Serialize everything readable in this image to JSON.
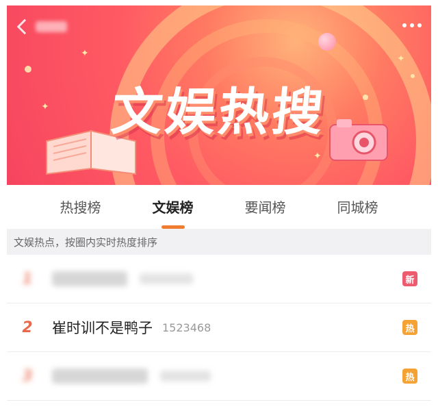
{
  "header": {
    "back_label": "返回",
    "banner_title": "文娱热搜"
  },
  "tabs": [
    {
      "label": "热搜榜",
      "active": false
    },
    {
      "label": "文娱榜",
      "active": true
    },
    {
      "label": "要闻榜",
      "active": false
    },
    {
      "label": "同城榜",
      "active": false
    }
  ],
  "subheader": "文娱热点，按圈内实时热度排序",
  "list": {
    "items": [
      {
        "rank": "1",
        "title": "",
        "count": "",
        "badge": "新",
        "badge_color": "#ee5b6f",
        "blurred": true
      },
      {
        "rank": "2",
        "title": "崔时训不是鸭子",
        "count": "1523468",
        "badge": "热",
        "badge_color": "#f5a235",
        "blurred": false
      },
      {
        "rank": "3",
        "title": "",
        "count": "",
        "badge": "热",
        "badge_color": "#f5a235",
        "blurred": true
      }
    ]
  },
  "colors": {
    "accent": "#f07d2f",
    "rank": "#e8684b",
    "banner": "#f6455f"
  },
  "icons": {
    "back": "chevron-left-icon",
    "more": "more-dots-icon"
  }
}
